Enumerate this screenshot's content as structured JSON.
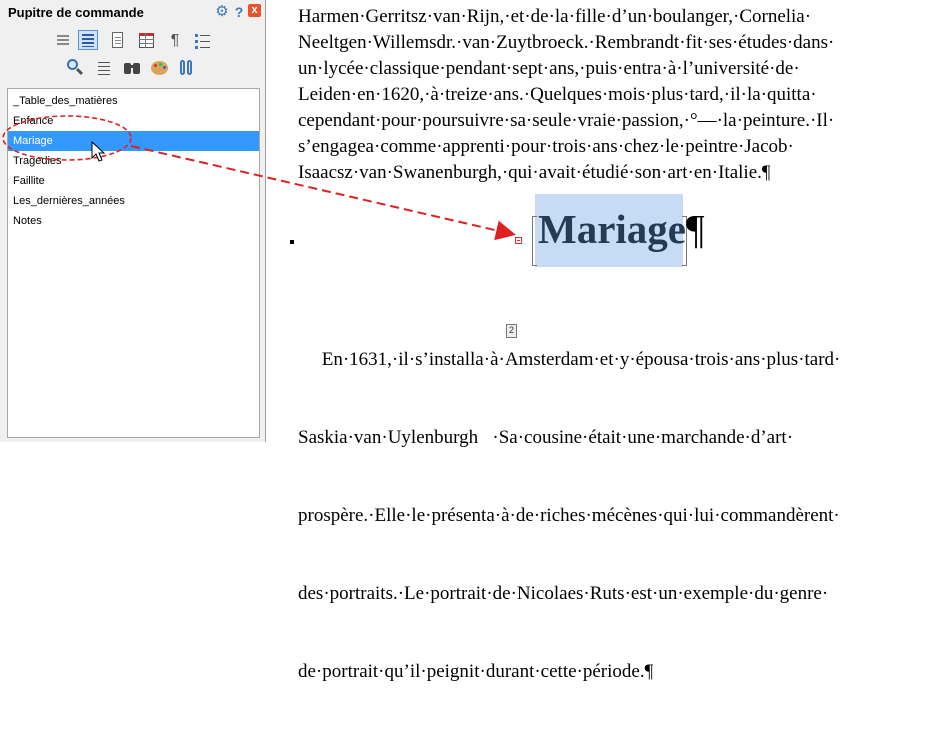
{
  "panel": {
    "title": "Pupitre de commande",
    "help": "?",
    "close": "x"
  },
  "outline": {
    "items": [
      {
        "label": "_Table_des_matières"
      },
      {
        "label": "Enfance"
      },
      {
        "label": "Mariage"
      },
      {
        "label": "Tragedies"
      },
      {
        "label": "Faillite"
      },
      {
        "label": "Les_dernières_années"
      },
      {
        "label": "Notes"
      }
    ],
    "selected": "Mariage"
  },
  "document": {
    "p1_lines": [
      "Harmen·Gerritsz·van·Rijn,·et·de·la·fille·d’un·boulanger,·Cornelia·",
      "Neeltgen·Willemsdr.·van·Zuytbroeck.·Rembrandt·fit·ses·études·dans·",
      "un·lycée·classique·pendant·sept·ans,·puis·entra·à·l’université·de·",
      "Leiden·en·1620,·à·treize·ans.·Quelques·mois·plus·tard,·il·la·quitta·",
      "cependant·pour·poursuivre·sa·seule·vraie·passion,·°—·la·peinture.·Il·",
      "s’engagea·comme·apprenti·pour·trois·ans·chez·le·peintre·Jacob·",
      "Isaacsz·van·Swanenburgh,·qui·avait·étudié·son·art·en·Italie.¶"
    ],
    "heading": "Mariage",
    "heading_mark": "¶",
    "footnote_mark": "2",
    "p2_lines": [
      "     En·1631,·il·s’installa·à·Amsterdam·et·y·épousa·trois·ans·plus·tard·",
      "Saskia·van·Uylenburgh   ·Sa·cousine·était·une·marchande·d’art·",
      "prospère.·Elle·le·présenta·à·de·riches·mécènes·qui·lui·commandèrent·",
      "des·portraits.·Le·portrait·de·Nicolaes·Ruts·est·un·exemple·du·genre·",
      "de·portrait·qu’il·peignit·durant·cette·période.¶"
    ]
  },
  "colors": {
    "selection": "#3399ff",
    "heading_highlight": "#c6dcf5",
    "annotation": "#e02020"
  },
  "icons": {
    "toolbar_row1": [
      "headings-icon",
      "outline-icon",
      "page-icon",
      "table-icon",
      "pilcrow-icon",
      "list-icon"
    ],
    "toolbar_row2": [
      "zoom-icon",
      "text-icon",
      "binoculars-icon",
      "palette-icon",
      "paperclip-icon"
    ]
  }
}
